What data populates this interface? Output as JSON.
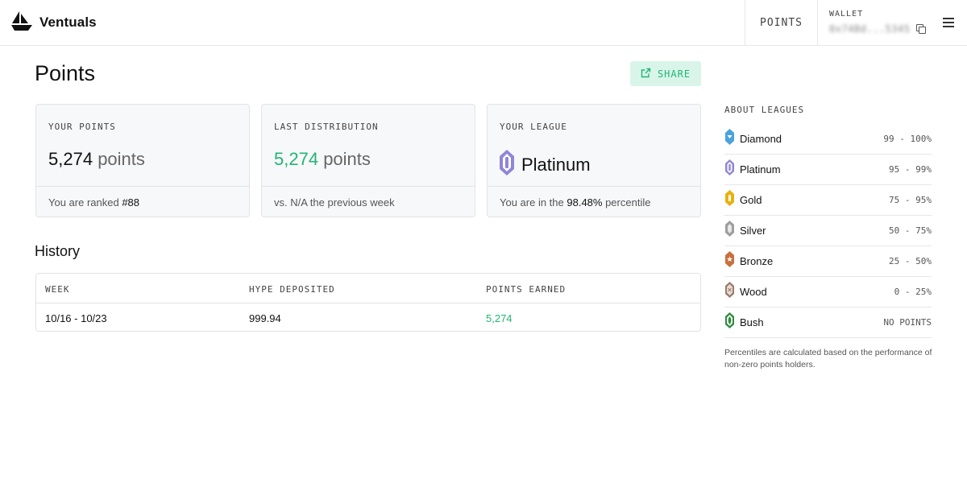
{
  "app": {
    "name": "Ventuals"
  },
  "nav": {
    "points": "POINTS"
  },
  "wallet": {
    "label": "WALLET",
    "address": "0x74Bd...5345"
  },
  "page": {
    "title": "Points",
    "share": "SHARE"
  },
  "cards": {
    "your_points": {
      "label": "YOUR POINTS",
      "value": "5,274",
      "unit": "points",
      "foot_prefix": "You are ranked ",
      "rank": "#88"
    },
    "last_distribution": {
      "label": "LAST DISTRIBUTION",
      "value": "5,274",
      "unit": "points",
      "foot": "vs. N/A the previous week"
    },
    "your_league": {
      "label": "YOUR LEAGUE",
      "league": "Platinum",
      "foot_prefix": "You are in the ",
      "percentile": "98.48%",
      "foot_suffix": " percentile"
    }
  },
  "history": {
    "title": "History",
    "columns": [
      "WEEK",
      "HYPE DEPOSITED",
      "POINTS EARNED"
    ],
    "rows": [
      {
        "week": "10/16 - 10/23",
        "hype": "999.94",
        "points": "5,274"
      }
    ]
  },
  "about": {
    "label": "ABOUT LEAGUES",
    "leagues": [
      {
        "name": "Diamond",
        "range": "99 - 100%",
        "color": "#4aa3df"
      },
      {
        "name": "Platinum",
        "range": "95 - 99%",
        "color": "#8f86d8"
      },
      {
        "name": "Gold",
        "range": "75 - 95%",
        "color": "#e9b10f"
      },
      {
        "name": "Silver",
        "range": "50 - 75%",
        "color": "#9e9e9e"
      },
      {
        "name": "Bronze",
        "range": "25 - 50%",
        "color": "#c9703f"
      },
      {
        "name": "Wood",
        "range": "0 - 25%",
        "color": "#9b7b6c"
      },
      {
        "name": "Bush",
        "range": "NO POINTS",
        "color": "#2e8b3e"
      }
    ],
    "note": "Percentiles are calculated based on the performance of non-zero points holders."
  },
  "colors": {
    "accent_green": "#22b573",
    "share_bg": "#d9f5e9"
  }
}
